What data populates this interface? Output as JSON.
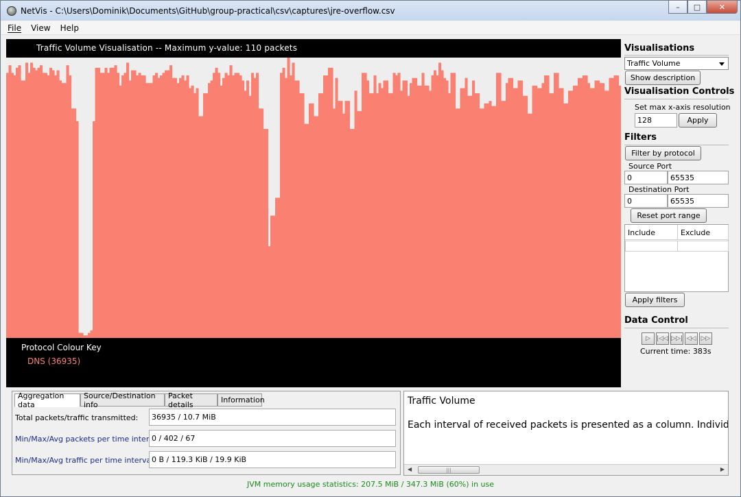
{
  "window": {
    "title": "NetVis - C:\\Users\\Dominik\\Documents\\GitHub\\group-practical\\csv\\captures\\jre-overflow.csv",
    "controls": [
      "–",
      "□",
      "✕"
    ]
  },
  "menu": [
    {
      "label": "File"
    },
    {
      "label": "View"
    },
    {
      "label": "Help"
    }
  ],
  "visualisation": {
    "title": "Traffic Volume Visualisation -- Maximum y-value: 110 packets",
    "key_title": "Protocol Colour Key",
    "key_entry": "DNS (36935)",
    "bar_color": "#fa8072",
    "background_color": "#eeeeee"
  },
  "chart_data": {
    "type": "bar",
    "ylim": [
      0,
      110
    ],
    "series": [
      {
        "color": "#fa8072",
        "values": [
          104,
          107,
          104,
          103,
          106,
          107,
          101,
          101,
          108,
          104,
          108,
          106,
          105,
          106,
          107,
          104,
          104,
          103,
          106,
          105,
          103,
          105,
          101,
          100,
          100,
          107,
          103,
          90,
          90,
          85,
          2,
          2,
          1,
          1,
          2,
          3,
          85,
          106,
          106,
          104,
          104,
          106,
          104,
          106,
          106,
          107,
          104,
          99,
          103,
          104,
          108,
          101,
          105,
          105,
          103,
          104,
          103,
          103,
          100,
          100,
          100,
          103,
          104,
          102,
          103,
          104,
          105,
          105,
          107,
          102,
          102,
          100,
          102,
          103,
          101,
          103,
          98,
          99,
          96,
          98,
          87,
          87,
          96,
          96,
          100,
          101,
          104,
          106,
          104,
          99,
          102,
          104,
          103,
          107,
          103,
          104,
          104,
          103,
          101,
          97,
          101,
          95,
          104,
          102,
          104,
          90,
          90,
          82,
          82,
          36,
          48,
          48,
          55,
          55,
          104,
          106,
          102,
          110,
          103,
          108,
          101,
          101,
          96,
          96,
          84,
          84,
          92,
          92,
          87,
          87,
          96,
          96,
          103,
          103,
          106,
          106,
          90,
          102,
          93,
          93,
          88,
          93,
          93,
          82,
          82,
          97,
          89,
          89,
          104,
          104,
          101,
          96,
          96,
          103,
          96,
          100,
          98,
          101,
          101,
          96,
          96,
          104,
          103,
          104,
          97,
          101,
          101,
          95,
          100,
          102,
          102,
          99,
          99,
          104,
          99,
          99,
          97,
          103,
          105,
          103,
          108,
          105,
          102,
          101,
          96,
          104,
          104,
          90,
          90,
          98,
          98,
          102,
          95,
          95,
          101,
          96,
          96,
          90,
          90,
          92,
          92,
          93,
          91,
          91,
          104,
          104,
          93,
          93,
          100,
          102,
          102,
          98,
          98,
          101,
          101,
          95,
          95,
          88,
          88,
          99,
          99,
          98,
          98,
          100,
          103,
          103,
          96,
          96,
          104,
          104,
          98,
          98,
          92,
          92,
          97,
          97,
          99,
          99,
          102,
          102,
          103,
          103,
          100,
          98,
          98,
          101,
          101,
          100,
          100,
          97,
          97,
          102,
          102,
          103,
          103,
          99
        ]
      }
    ]
  },
  "sidebar": {
    "visualisations_heading": "Visualisations",
    "vis_select": "Traffic Volume",
    "show_description": "Show description",
    "controls_heading": "Visualisation Controls",
    "max_res_label": "Set max x-axis resolution",
    "max_res_value": "128",
    "apply": "Apply",
    "filters_heading": "Filters",
    "filter_protocol": "Filter by protocol",
    "source_port_label": "Source Port",
    "source_port_from": "0",
    "source_port_to": "65535",
    "dest_port_label": "Destination Port",
    "dest_port_from": "0",
    "dest_port_to": "65535",
    "reset_ports": "Reset port range",
    "include_header": "Include",
    "exclude_header": "Exclude",
    "apply_filters": "Apply filters",
    "data_control_heading": "Data Control",
    "current_time": "Current time: 383s"
  },
  "tabs": [
    {
      "label": "Aggregation data"
    },
    {
      "label": "Source/Destination info"
    },
    {
      "label": "Packet details"
    },
    {
      "label": "Information"
    }
  ],
  "aggregation": {
    "rows": [
      {
        "label": "Total packets/traffic transmitted:",
        "value": "36935 / 10.7 MiB"
      },
      {
        "label": "Min/Max/Avg packets per time interval:",
        "value": "0 / 402 / 67"
      },
      {
        "label": "Min/Max/Avg traffic per time interval:",
        "value": "0 B / 119.3 KiB / 19.9 KiB"
      }
    ]
  },
  "description": {
    "title": "Traffic Volume",
    "text": "Each interval of received packets is presented as a column. Individual p"
  },
  "status": "JVM memory usage statistics: 207.5 MiB / 347.3 MiB (60%) in use"
}
